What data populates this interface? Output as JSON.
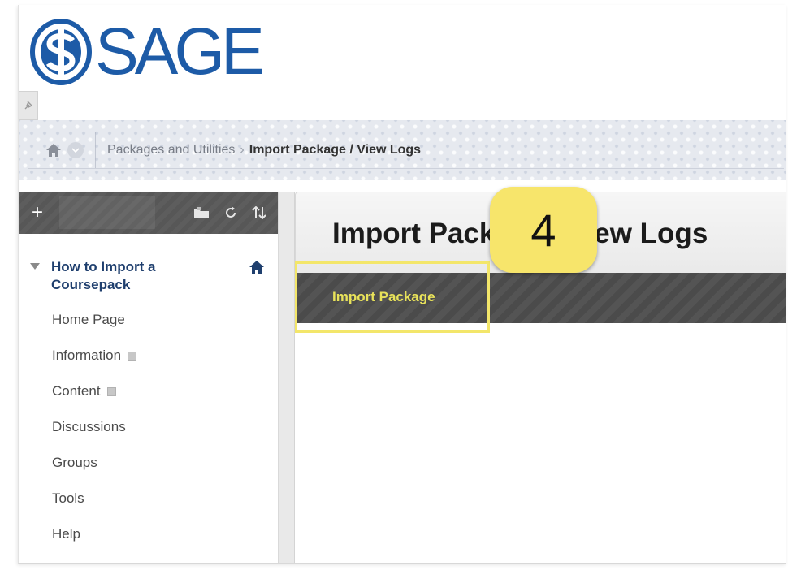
{
  "brand": {
    "name": "SAGE",
    "accent": "#1d5ba7"
  },
  "breadcrumb": {
    "items": [
      "Packages and Utilities",
      "Import Package / View Logs"
    ],
    "separator": "›"
  },
  "sidebar": {
    "course_title": "How to Import a Coursepack",
    "items": [
      {
        "label": "Home Page",
        "has_badge": false
      },
      {
        "label": "Information",
        "has_badge": true
      },
      {
        "label": "Content",
        "has_badge": true
      },
      {
        "label": "Discussions",
        "has_badge": false
      },
      {
        "label": "Groups",
        "has_badge": false
      },
      {
        "label": "Tools",
        "has_badge": false
      },
      {
        "label": "Help",
        "has_badge": false
      }
    ],
    "toolbar": {
      "add_label": "+"
    }
  },
  "main": {
    "page_title": "Import Package / View Logs",
    "action_label": "Import Package",
    "step_badge": "4",
    "highlight_color": "#f3e66a"
  }
}
